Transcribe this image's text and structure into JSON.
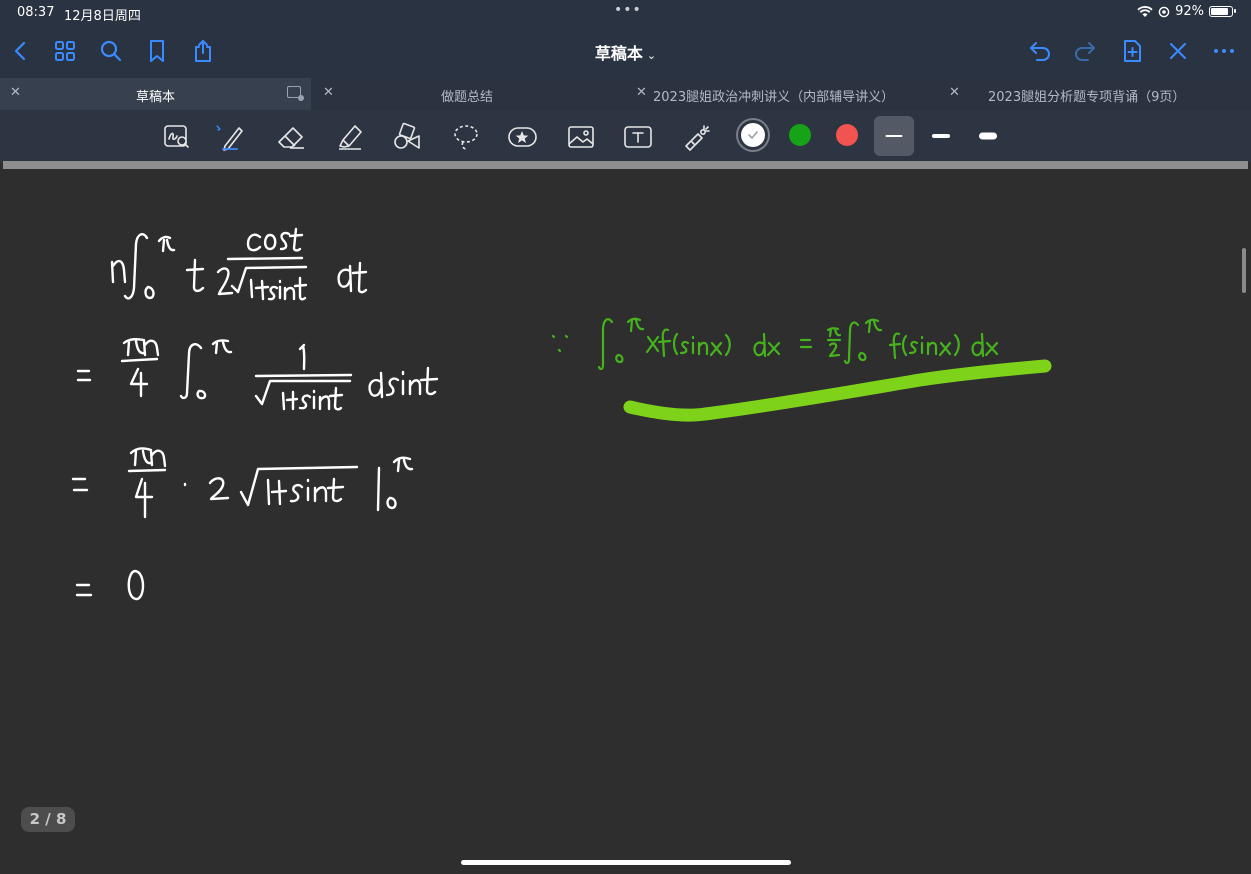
{
  "status_bar": {
    "time": "08:37",
    "date": "12月8日周四",
    "center": "•••",
    "battery_text": "92%",
    "battery_level": 0.92
  },
  "nav": {
    "title": "草稿本",
    "title_chevron": "⌄",
    "icons_left": [
      "back-icon",
      "grid-icon",
      "search-icon",
      "bookmark-icon",
      "share-icon"
    ],
    "icons_right": [
      "undo-icon",
      "redo-icon",
      "add-page-icon",
      "close-icon",
      "more-icon"
    ]
  },
  "tabs": [
    {
      "label": "草稿本",
      "active": true
    },
    {
      "label": "做题总结",
      "active": false
    },
    {
      "label": "2023腿姐政治冲刺讲义（内部辅导讲义）",
      "active": false
    },
    {
      "label": "2023腿姐分析题专项背诵（9页）",
      "active": false
    }
  ],
  "toolbar": {
    "tools": [
      "zoom-lasso-icon",
      "pen-icon",
      "eraser-icon",
      "highlighter-icon",
      "shapes-icon",
      "lasso-icon",
      "sticker-icon",
      "image-icon",
      "text-icon",
      "laser-pointer-icon"
    ],
    "colors": [
      "#ffffff",
      "#17a317",
      "#f15350"
    ],
    "selected_color_index": 0,
    "stroke_sizes": [
      "thin",
      "medium",
      "thick"
    ],
    "selected_stroke_index": 0
  },
  "page_indicator": "2 / 8",
  "accent_color": "#3a8bff",
  "ink_colors": {
    "white": "#ffffff",
    "green": "#46b21c",
    "highlight": "#7ed31a"
  }
}
